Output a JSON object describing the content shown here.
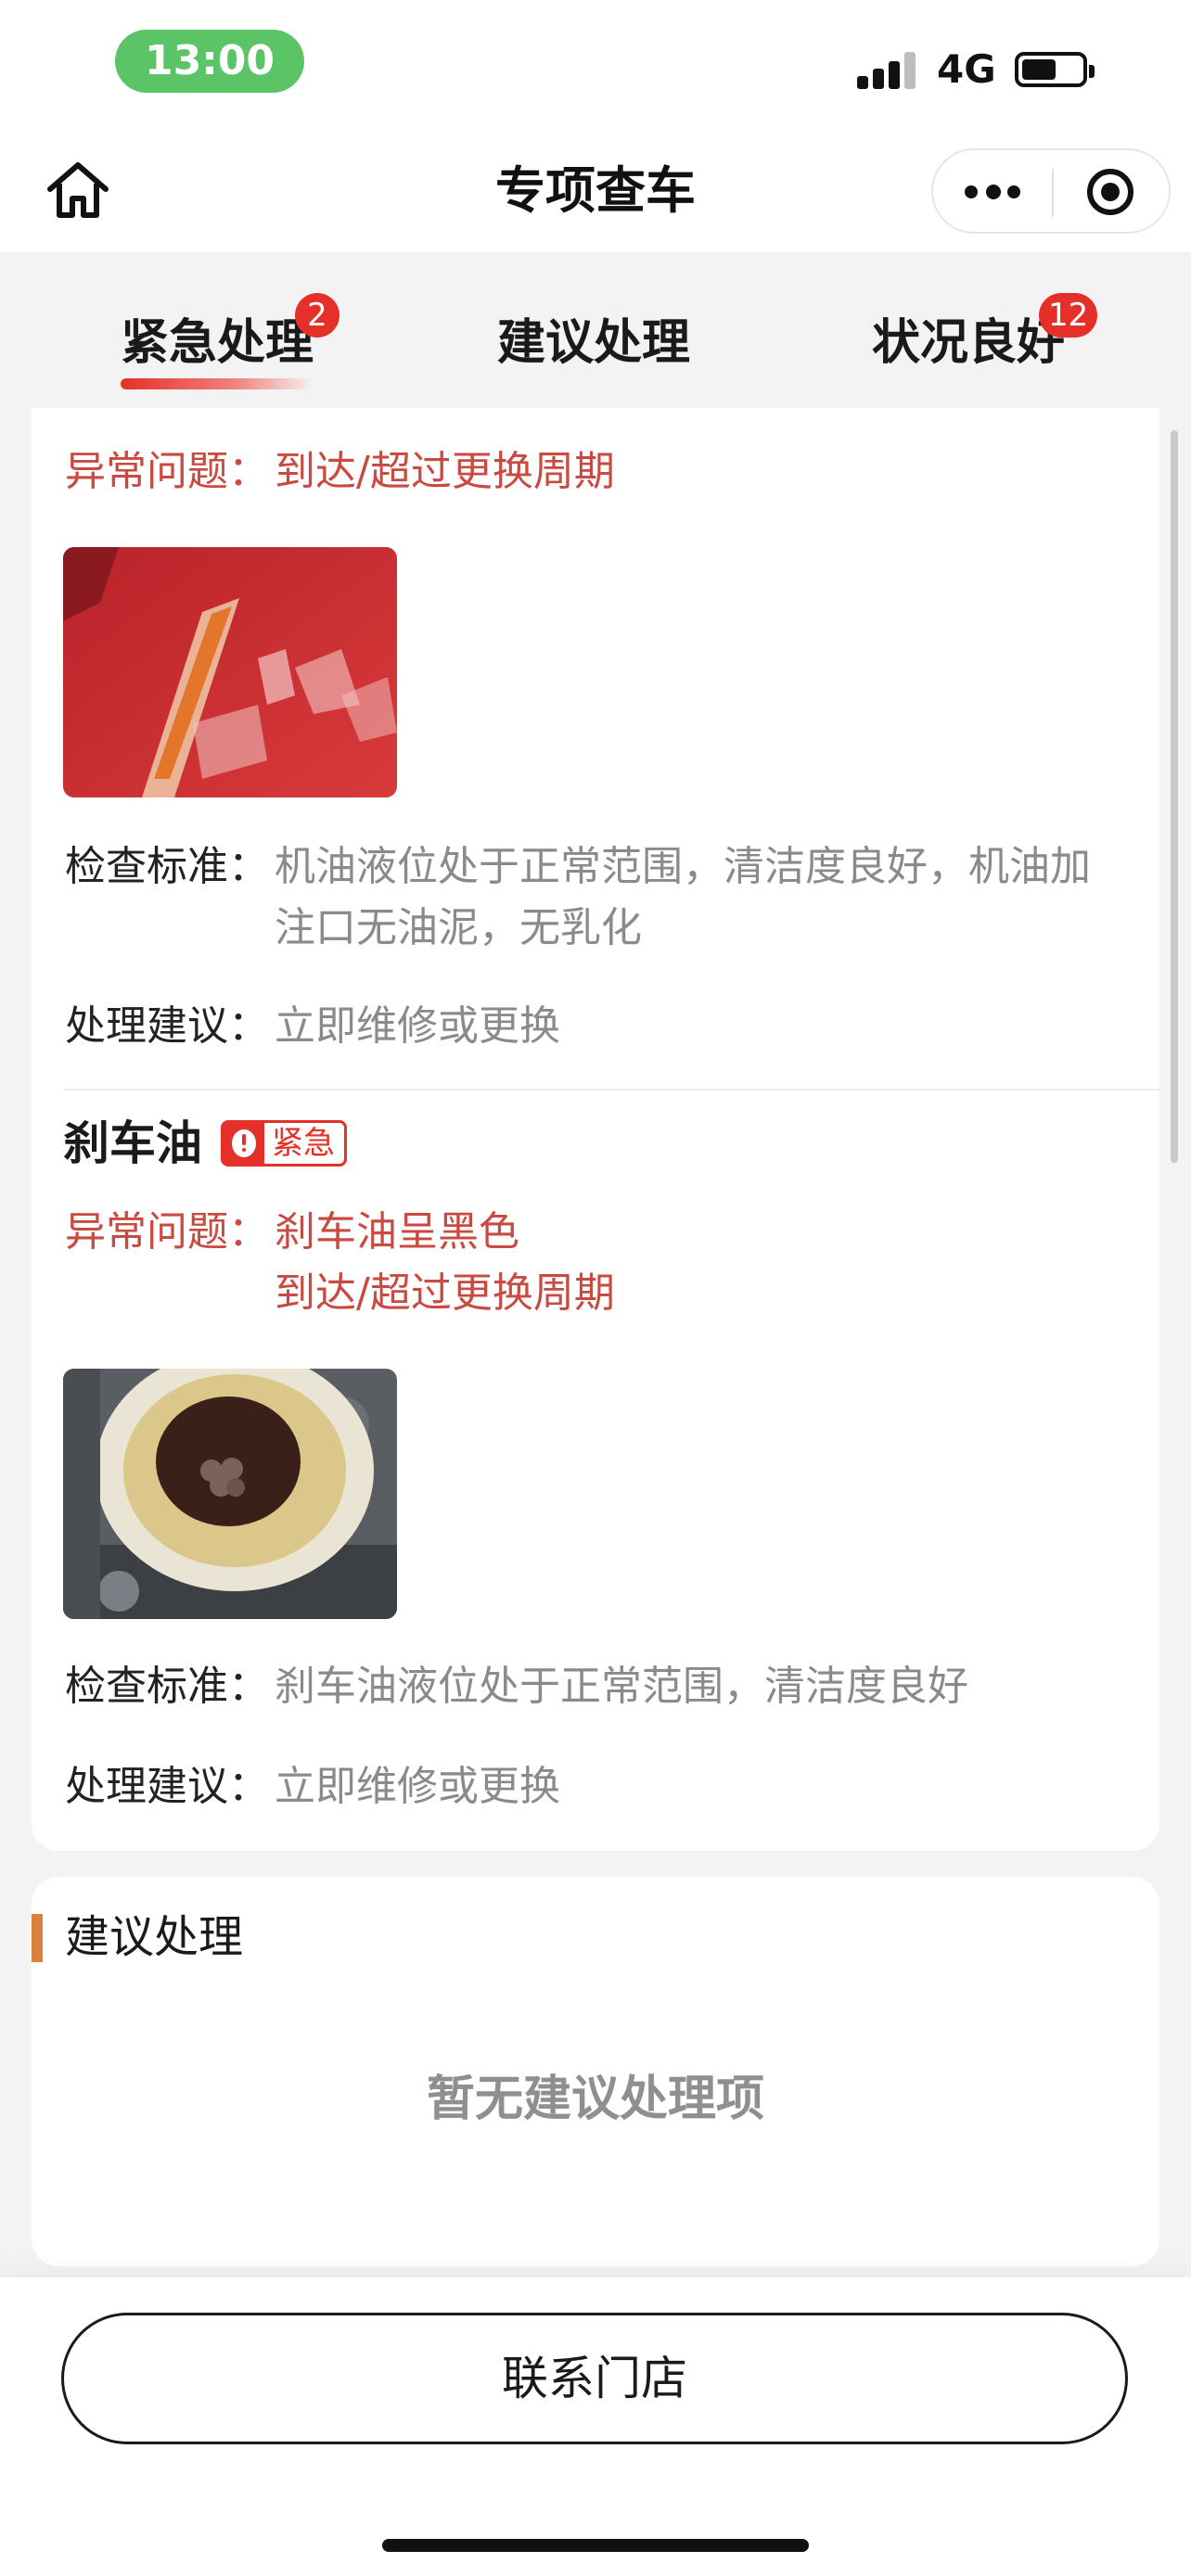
{
  "status_bar": {
    "time": "13:00",
    "network": "4G"
  },
  "nav": {
    "title": "专项查车"
  },
  "tabs": [
    {
      "label": "紧急处理",
      "badge": "2",
      "active": true
    },
    {
      "label": "建议处理",
      "badge": "",
      "active": false
    },
    {
      "label": "状况良好",
      "badge": "12",
      "active": false
    }
  ],
  "urgent_items": [
    {
      "title": "",
      "issue_label": "异常问题：",
      "issues": [
        "到达/超过更换周期"
      ],
      "photo": "engine-oil-dipstick-photo",
      "standard_label": "检查标准：",
      "standard_lines": [
        "机油液位处于正常范围，清洁度良好，机油加",
        "注口无油泥，无乳化"
      ],
      "advice_label": "处理建议：",
      "advice": "立即维修或更换"
    },
    {
      "title": "刹车油",
      "tag": "紧急",
      "issue_label": "异常问题：",
      "issues": [
        "刹车油呈黑色",
        "到达/超过更换周期"
      ],
      "photo": "brake-fluid-reservoir-photo",
      "standard_label": "检查标准：",
      "standard_lines": [
        "刹车油液位处于正常范围，清洁度良好"
      ],
      "advice_label": "处理建议：",
      "advice": "立即维修或更换"
    }
  ],
  "suggest_section": {
    "title": "建议处理",
    "empty_text": "暂无建议处理项"
  },
  "footer": {
    "contact_label": "联系门店"
  },
  "colors": {
    "status_pill": "#5bc466",
    "accent_red": "#e5302a",
    "issue_text": "#c94a40",
    "section_bar": "#d9823f"
  },
  "icons": {
    "home": "home-icon",
    "more": "more-dots-icon",
    "close": "target-close-icon",
    "urgent": "exclamation-icon"
  }
}
